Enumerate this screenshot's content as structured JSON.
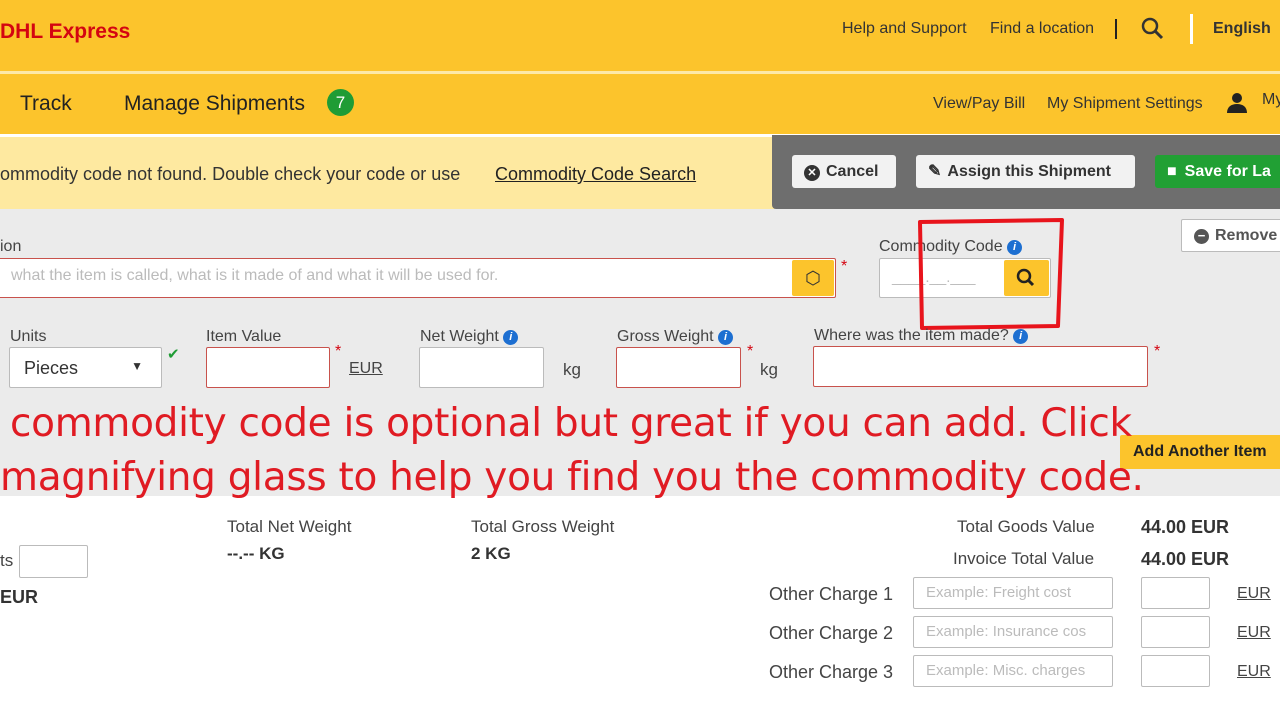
{
  "header": {
    "logo": "DHL Express",
    "links": [
      "Help and Support",
      "Find a location"
    ],
    "language": "English"
  },
  "nav": {
    "items": [
      "Track",
      "Manage Shipments"
    ],
    "badge": "7",
    "right": [
      "View/Pay Bill",
      "My Shipment Settings",
      "My"
    ]
  },
  "notice": {
    "text": "ommodity code not found. Double check your code or use",
    "link": "Commodity Code Search"
  },
  "actions": {
    "cancel": "Cancel",
    "assign": "Assign this Shipment",
    "save": "Save for La",
    "remove": "Remove"
  },
  "form": {
    "description_label": "ion",
    "description_placeholder": "what the item is called, what is it made of and what it will be used for.",
    "commodity_label": "Commodity Code",
    "commodity_placeholder": "____.__.___",
    "units_label": "Units",
    "units_value": "Pieces",
    "item_value_label": "Item Value",
    "currency": "EUR",
    "net_weight_label": "Net Weight",
    "gross_weight_label": "Gross Weight",
    "weight_unit": "kg",
    "origin_label": "Where was the item made?",
    "add_item": "Add Another Item"
  },
  "annotation": {
    "line1": "commodity code is optional but great if you can add. Click",
    "line2": "magnifying glass to help you find you the commodity code.",
    "color": "#e01b23"
  },
  "totals": {
    "units_label": "ts",
    "eur_left": "EUR",
    "net_label": "Total Net Weight",
    "net_value": "--.-- KG",
    "gross_label": "Total Gross Weight",
    "gross_value": "2 KG",
    "goods_label": "Total Goods Value",
    "goods_value": "44.00 EUR",
    "invoice_label": "Invoice Total Value",
    "invoice_value": "44.00 EUR",
    "charges": [
      {
        "label": "Other Charge 1",
        "placeholder": "Example: Freight cost",
        "currency": "EUR"
      },
      {
        "label": "Other Charge 2",
        "placeholder": "Example: Insurance cos",
        "currency": "EUR"
      },
      {
        "label": "Other Charge 3",
        "placeholder": "Example: Misc. charges",
        "currency": "EUR"
      }
    ]
  }
}
